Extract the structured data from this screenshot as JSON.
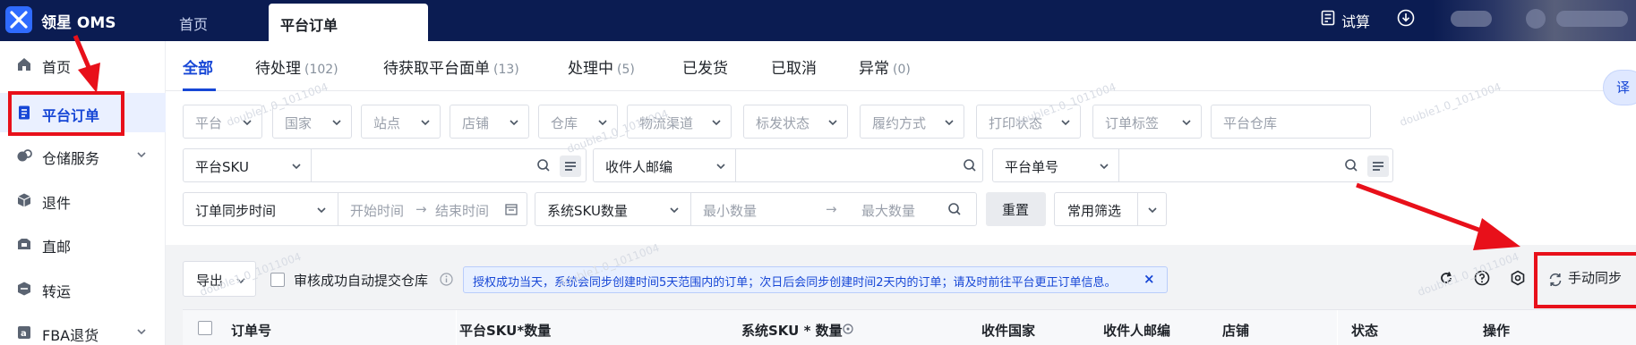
{
  "app": {
    "brand": "领星 OMS"
  },
  "topnav": {
    "home": "首页",
    "active_tab": "平台订单",
    "trial": "试算"
  },
  "sidebar": {
    "items": [
      {
        "label": "首页",
        "icon": "home-icon"
      },
      {
        "label": "平台订单",
        "icon": "order-icon",
        "active": true
      },
      {
        "label": "仓储服务",
        "icon": "warehouse-icon",
        "expandable": true
      },
      {
        "label": "退件",
        "icon": "return-icon"
      },
      {
        "label": "直邮",
        "icon": "direct-mail-icon"
      },
      {
        "label": "转运",
        "icon": "transship-icon"
      },
      {
        "label": "FBA退货",
        "icon": "fba-return-icon",
        "expandable": true
      }
    ]
  },
  "tabs": [
    {
      "label": "全部",
      "count": "",
      "active": true
    },
    {
      "label": "待处理",
      "count": "(102)"
    },
    {
      "label": "待获取平台面单",
      "count": "(13)"
    },
    {
      "label": "处理中",
      "count": "(5)"
    },
    {
      "label": "已发货",
      "count": ""
    },
    {
      "label": "已取消",
      "count": ""
    },
    {
      "label": "异常",
      "count": "(0)"
    }
  ],
  "filters": {
    "row1": [
      "平台",
      "国家",
      "站点",
      "店铺",
      "仓库",
      "物流渠道",
      "标发状态",
      "履约方式",
      "打印状态",
      "订单标签",
      "平台仓库"
    ],
    "sku_type": "平台SKU",
    "postcode_type": "收件人邮编",
    "order_no_type": "平台单号",
    "date_type": "订单同步时间",
    "start_placeholder": "开始时间",
    "end_placeholder": "结束时间",
    "qty_type": "系统SKU数量",
    "min_placeholder": "最小数量",
    "max_placeholder": "最大数量",
    "reset": "重置",
    "common_filter": "常用筛选"
  },
  "toolbar": {
    "export": "导出",
    "auto_submit": "审核成功自动提交仓库",
    "notice": "授权成功当天，系统会同步创建时间5天范围内的订单；次日后会同步创建时间2天内的订单；请及时前往平台更正订单信息。",
    "notice_close": "×",
    "manual_sync": "手动同步"
  },
  "table": {
    "columns": [
      "订单号",
      "平台SKU*数量",
      "系统SKU * 数量",
      "收件国家",
      "收件人邮编",
      "店铺",
      "状态",
      "操作"
    ]
  },
  "watermark": "double1.0_1011004",
  "translate": "译",
  "colors": {
    "topbar": "#0b1c52",
    "accent": "#1747d6",
    "annotation": "#e8101a"
  }
}
